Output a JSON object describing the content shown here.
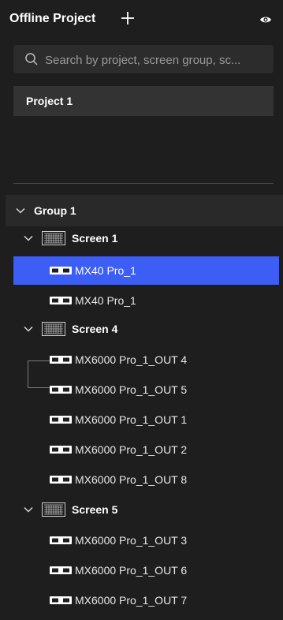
{
  "header": {
    "title": "Offline Project",
    "add_icon": "plus-icon",
    "visibility_icon": "eye-icon"
  },
  "search": {
    "value": "",
    "placeholder": "Search by project, screen group, sc..."
  },
  "projects": [
    {
      "label": "Project 1"
    }
  ],
  "tree": {
    "group": {
      "label": "Group 1"
    },
    "screens": [
      {
        "label": "Screen 1",
        "devices": [
          {
            "label": "MX40 Pro_1",
            "selected": true
          },
          {
            "label": "MX40 Pro_1",
            "selected": false
          }
        ]
      },
      {
        "label": "Screen 4",
        "devices": [
          {
            "label": "MX6000 Pro_1_OUT 4"
          },
          {
            "label": "MX6000 Pro_1_OUT 5"
          },
          {
            "label": "MX6000 Pro_1_OUT 1"
          },
          {
            "label": "MX6000 Pro_1_OUT 2"
          },
          {
            "label": "MX6000 Pro_1_OUT 8"
          }
        ]
      },
      {
        "label": "Screen 5",
        "devices": [
          {
            "label": "MX6000 Pro_1_OUT 3"
          },
          {
            "label": "MX6000 Pro_1_OUT 6"
          },
          {
            "label": "MX6000 Pro_1_OUT 7"
          }
        ]
      }
    ]
  },
  "colors": {
    "background": "#1e1e1e",
    "selected": "#3d5ef5"
  }
}
